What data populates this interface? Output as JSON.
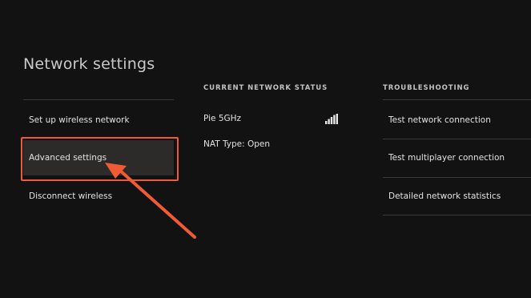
{
  "page": {
    "title": "Network settings"
  },
  "menu": {
    "items": [
      {
        "label": "Set up wireless network"
      },
      {
        "label": "Advanced settings",
        "selected": true
      },
      {
        "label": "Disconnect wireless"
      }
    ]
  },
  "status": {
    "heading": "CURRENT NETWORK STATUS",
    "network_name": "Pie 5GHz",
    "nat_type": "NAT Type: Open",
    "signal_icon": "signal-bars-icon"
  },
  "troubleshooting": {
    "heading": "TROUBLESHOOTING",
    "items": [
      {
        "label": "Test network connection"
      },
      {
        "label": "Test multiplayer connection"
      },
      {
        "label": "Detailed network statistics"
      }
    ]
  },
  "colors": {
    "background": "#121213",
    "highlight": "#f05a35",
    "selected_item": "#2c2b2a",
    "divider": "#3a3a3b"
  },
  "annotation": {
    "arrow_icon": "pointer-arrow-icon"
  }
}
